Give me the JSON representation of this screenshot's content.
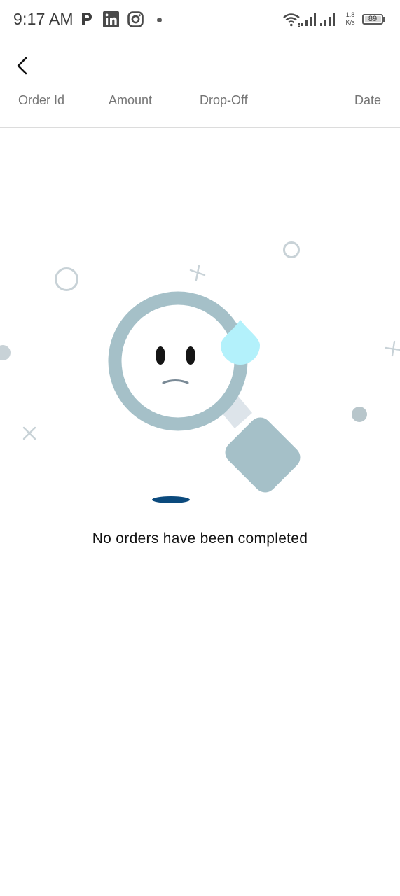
{
  "status_bar": {
    "time": "9:17 AM",
    "net_speed_value": "1.8",
    "net_speed_unit": "K/s",
    "battery_level": "89",
    "icons": [
      "paytm-icon",
      "linkedin-icon",
      "instagram-icon",
      "wifi-icon",
      "signal-icon",
      "signal-icon-2",
      "battery-icon"
    ]
  },
  "app_bar": {
    "back_icon": "chevron-left-icon"
  },
  "table": {
    "columns": [
      "Order Id",
      "Amount",
      "Drop-Off",
      "Date"
    ]
  },
  "empty_state": {
    "message": "No orders have been completed",
    "illustration": "sad-magnifying-glass"
  },
  "colors": {
    "lens": "#a5c0c8",
    "drop": "#b3f1fb",
    "shadow": "#0b4a7d",
    "deco": "#c8d2d7"
  }
}
